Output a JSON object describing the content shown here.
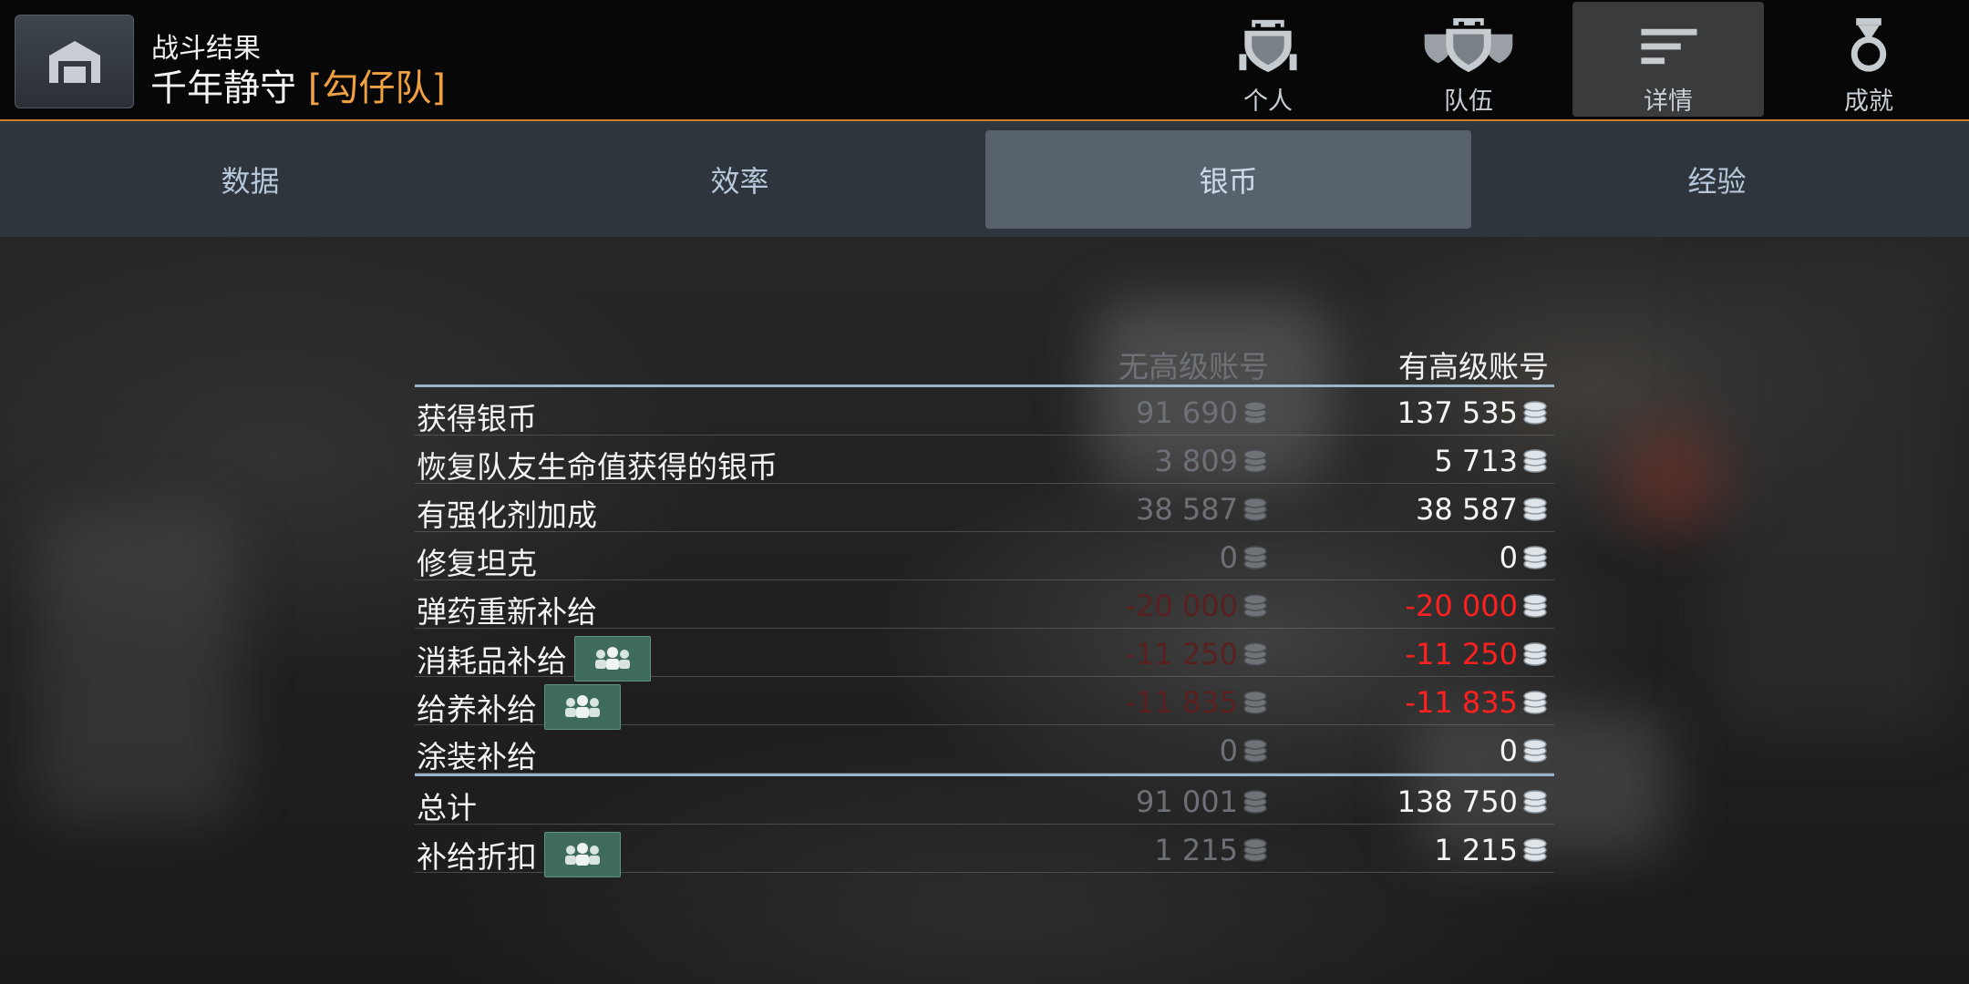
{
  "header": {
    "subtitle": "战斗结果",
    "map_name": "千年静守",
    "clan_tag": "[勾仔队]",
    "accent_color": "#c8802a",
    "nav": [
      {
        "label": "个人",
        "icon": "single-tank-shield-icon",
        "active": false
      },
      {
        "label": "队伍",
        "icon": "team-shields-icon",
        "active": false
      },
      {
        "label": "详情",
        "icon": "details-bars-icon",
        "active": true
      },
      {
        "label": "成就",
        "icon": "medal-icon",
        "active": false
      }
    ]
  },
  "tabs": [
    {
      "label": "数据",
      "active": false
    },
    {
      "label": "效率",
      "active": false
    },
    {
      "label": "银币",
      "active": true
    },
    {
      "label": "经验",
      "active": false
    }
  ],
  "table": {
    "col_no_premium": "无高级账号",
    "col_premium": "有高级账号",
    "rows": [
      {
        "label": "获得银币",
        "np": "91 690",
        "p": "137 535",
        "neg": false,
        "badge": false
      },
      {
        "label": "恢复队友生命值获得的银币",
        "np": "3 809",
        "p": "5 713",
        "neg": false,
        "badge": false
      },
      {
        "label": "有强化剂加成",
        "np": "38 587",
        "p": "38 587",
        "neg": false,
        "badge": false
      },
      {
        "label": "修复坦克",
        "np": "0",
        "p": "0",
        "neg": false,
        "badge": false
      },
      {
        "label": "弹药重新补给",
        "np": "-20 000",
        "p": "-20 000",
        "neg": true,
        "badge": false
      },
      {
        "label": "消耗品补给",
        "np": "-11 250",
        "p": "-11 250",
        "neg": true,
        "badge": true
      },
      {
        "label": "给养补给",
        "np": "-11 835",
        "p": "-11 835",
        "neg": true,
        "badge": true
      },
      {
        "label": "涂装补给",
        "np": "0",
        "p": "0",
        "neg": false,
        "badge": false
      }
    ],
    "totals": [
      {
        "label": "总计",
        "np": "91 001",
        "p": "138 750",
        "neg": false,
        "badge": false
      },
      {
        "label": "补给折扣",
        "np": "1 215",
        "p": "1 215",
        "neg": false,
        "badge": true
      }
    ]
  }
}
